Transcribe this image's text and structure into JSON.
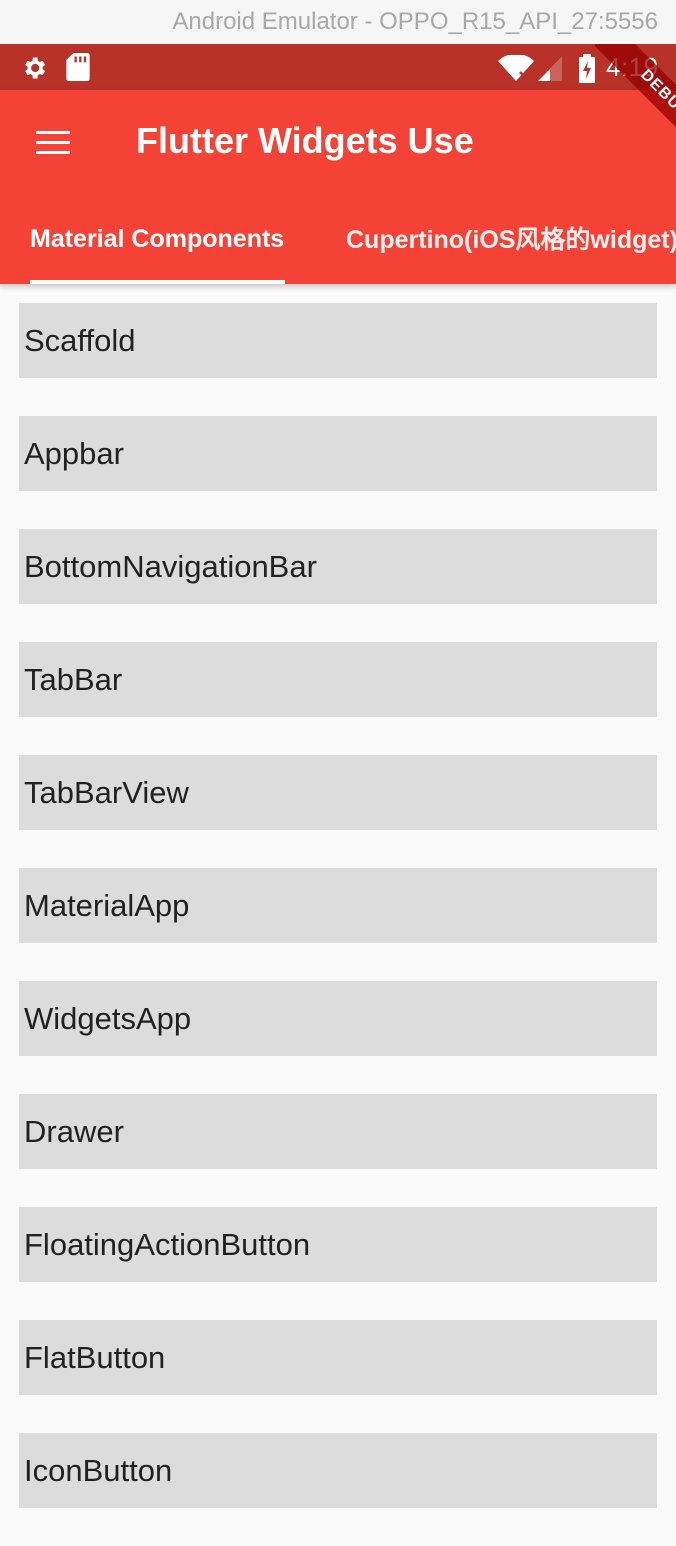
{
  "window": {
    "title": "Android Emulator - OPPO_R15_API_27:5556"
  },
  "status_bar": {
    "time": "4:19",
    "icons": [
      "gear-icon",
      "sd-card-icon",
      "wifi-icon",
      "signal-icon",
      "battery-icon"
    ]
  },
  "debug_banner": "DEBUG",
  "appbar": {
    "title": "Flutter Widgets Use",
    "menu_icon": "hamburger-menu-icon",
    "color": "#f44336"
  },
  "tabs": [
    {
      "label": "Material Components",
      "selected": true
    },
    {
      "label": "Cupertino(iOS风格的widget)",
      "selected": false
    }
  ],
  "list_items": [
    "Scaffold",
    "Appbar",
    "BottomNavigationBar",
    "TabBar",
    "TabBarView",
    "MaterialApp",
    "WidgetsApp",
    "Drawer",
    "FloatingActionButton",
    "FlatButton",
    "IconButton"
  ]
}
